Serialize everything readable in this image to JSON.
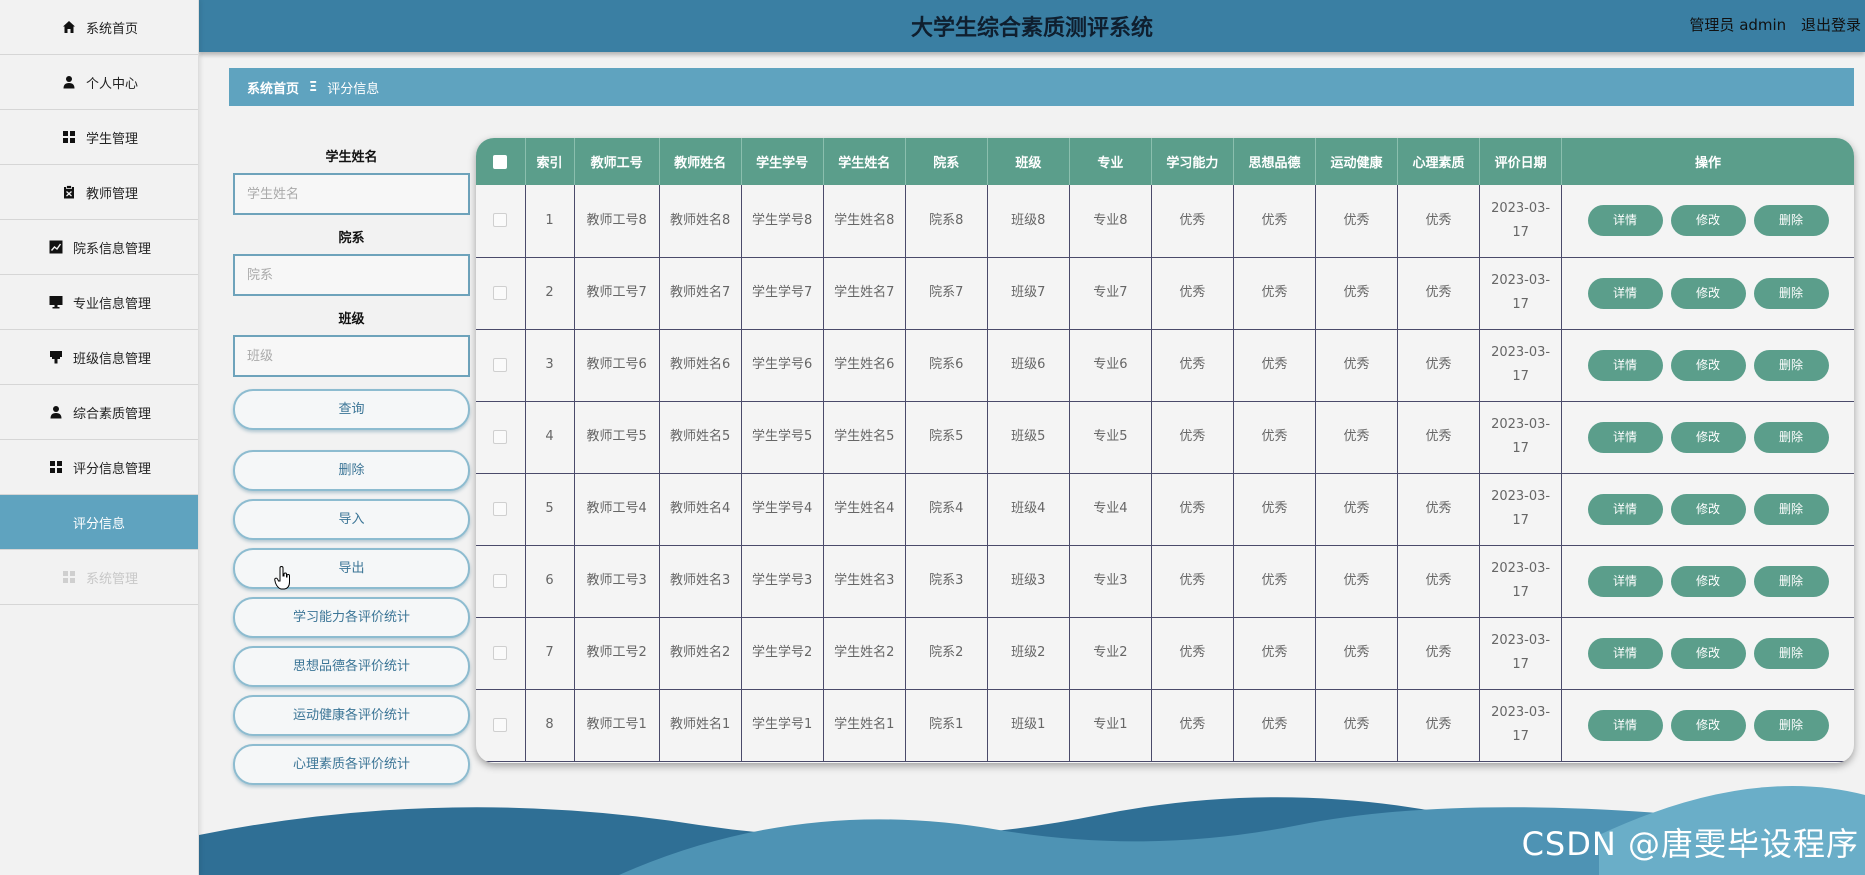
{
  "sidebar": {
    "items": [
      {
        "label": "系统首页",
        "icon": "home-icon"
      },
      {
        "label": "个人中心",
        "icon": "user-icon"
      },
      {
        "label": "学生管理",
        "icon": "grid-icon"
      },
      {
        "label": "教师管理",
        "icon": "clipboard-icon"
      },
      {
        "label": "院系信息管理",
        "icon": "chart-icon"
      },
      {
        "label": "专业信息管理",
        "icon": "monitor-icon"
      },
      {
        "label": "班级信息管理",
        "icon": "paint-icon"
      },
      {
        "label": "综合素质管理",
        "icon": "user-icon"
      },
      {
        "label": "评分信息管理",
        "icon": "grid-icon"
      },
      {
        "label": "评分信息",
        "icon": ""
      },
      {
        "label": "系统管理",
        "icon": "grid-icon"
      }
    ]
  },
  "header": {
    "title": "大学生综合素质测评系统",
    "user_label": "管理员 admin",
    "logout": "退出登录"
  },
  "breadcrumb": {
    "home": "系统首页",
    "sep": "Ξ",
    "current": "评分信息"
  },
  "search": {
    "name_label": "学生姓名",
    "name_placeholder": "学生姓名",
    "dept_label": "院系",
    "dept_placeholder": "院系",
    "class_label": "班级",
    "class_placeholder": "班级",
    "query": "查询",
    "delete": "删除",
    "import": "导入",
    "export": "导出",
    "stat1": "学习能力各评价统计",
    "stat2": "思想品德各评价统计",
    "stat3": "运动健康各评价统计",
    "stat4": "心理素质各评价统计"
  },
  "table": {
    "headers": [
      "索引",
      "教师工号",
      "教师姓名",
      "学生学号",
      "学生姓名",
      "院系",
      "班级",
      "专业",
      "学习能力",
      "思想品德",
      "运动健康",
      "心理素质",
      "评价日期",
      "操作"
    ],
    "actions": {
      "detail": "详情",
      "edit": "修改",
      "delete": "删除"
    },
    "rows": [
      [
        "1",
        "教师工号8",
        "教师姓名8",
        "学生学号8",
        "学生姓名8",
        "院系8",
        "班级8",
        "专业8",
        "优秀",
        "优秀",
        "优秀",
        "优秀",
        "2023-03-17"
      ],
      [
        "2",
        "教师工号7",
        "教师姓名7",
        "学生学号7",
        "学生姓名7",
        "院系7",
        "班级7",
        "专业7",
        "优秀",
        "优秀",
        "优秀",
        "优秀",
        "2023-03-17"
      ],
      [
        "3",
        "教师工号6",
        "教师姓名6",
        "学生学号6",
        "学生姓名6",
        "院系6",
        "班级6",
        "专业6",
        "优秀",
        "优秀",
        "优秀",
        "优秀",
        "2023-03-17"
      ],
      [
        "4",
        "教师工号5",
        "教师姓名5",
        "学生学号5",
        "学生姓名5",
        "院系5",
        "班级5",
        "专业5",
        "优秀",
        "优秀",
        "优秀",
        "优秀",
        "2023-03-17"
      ],
      [
        "5",
        "教师工号4",
        "教师姓名4",
        "学生学号4",
        "学生姓名4",
        "院系4",
        "班级4",
        "专业4",
        "优秀",
        "优秀",
        "优秀",
        "优秀",
        "2023-03-17"
      ],
      [
        "6",
        "教师工号3",
        "教师姓名3",
        "学生学号3",
        "学生姓名3",
        "院系3",
        "班级3",
        "专业3",
        "优秀",
        "优秀",
        "优秀",
        "优秀",
        "2023-03-17"
      ],
      [
        "7",
        "教师工号2",
        "教师姓名2",
        "学生学号2",
        "学生姓名2",
        "院系2",
        "班级2",
        "专业2",
        "优秀",
        "优秀",
        "优秀",
        "优秀",
        "2023-03-17"
      ],
      [
        "8",
        "教师工号1",
        "教师姓名1",
        "学生学号1",
        "学生姓名1",
        "院系1",
        "班级1",
        "专业1",
        "优秀",
        "优秀",
        "优秀",
        "优秀",
        "2023-03-17"
      ]
    ]
  },
  "watermark": "CSDN @唐雯毕设程序",
  "colors": {
    "primary": "#3a7fa3",
    "accent": "#5fa3bf",
    "table_head": "#5b9e8b"
  }
}
